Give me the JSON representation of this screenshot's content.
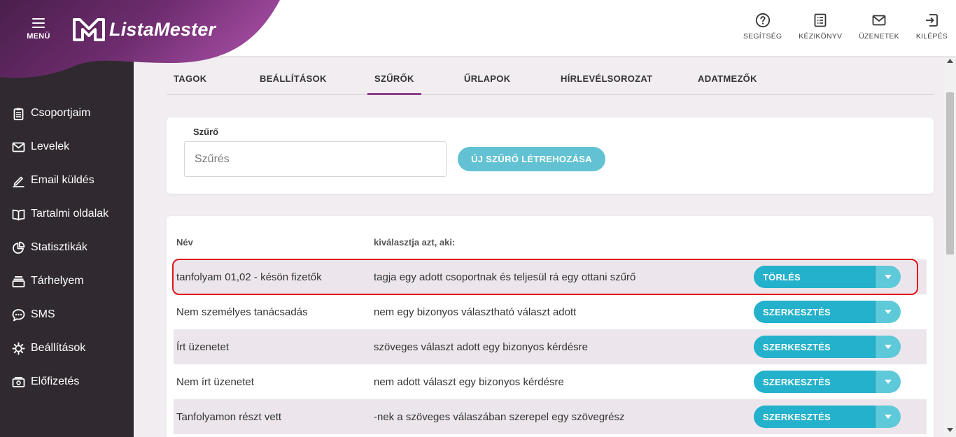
{
  "header": {
    "menu_label": "MENÜ",
    "logo_text": "ListaMester",
    "actions": [
      {
        "label": "SEGÍTSÉG",
        "icon": "help-icon"
      },
      {
        "label": "KÉZIKÖNYV",
        "icon": "manual-icon"
      },
      {
        "label": "ÜZENETEK",
        "icon": "mail-icon"
      },
      {
        "label": "KILÉPÉS",
        "icon": "logout-icon"
      }
    ]
  },
  "sidebar": {
    "items": [
      {
        "label": "Csoportjaim",
        "icon": "clipboard-icon"
      },
      {
        "label": "Levelek",
        "icon": "envelope-icon"
      },
      {
        "label": "Email küldés",
        "icon": "pen-icon"
      },
      {
        "label": "Tartalmi oldalak",
        "icon": "book-icon"
      },
      {
        "label": "Statisztikák",
        "icon": "pie-chart-icon"
      },
      {
        "label": "Tárhelyem",
        "icon": "storage-icon"
      },
      {
        "label": "SMS",
        "icon": "chat-bubble-icon"
      },
      {
        "label": "Beállítások",
        "icon": "gear-icon"
      },
      {
        "label": "Előfizetés",
        "icon": "subscription-icon"
      }
    ]
  },
  "tabs": [
    {
      "label": "TAGOK"
    },
    {
      "label": "BEÁLLÍTÁSOK"
    },
    {
      "label": "SZŰRŐK",
      "active": true
    },
    {
      "label": "ŰRLAPOK"
    },
    {
      "label": "HÍRLEVÉLSOROZAT"
    },
    {
      "label": "ADATMEZŐK"
    }
  ],
  "filter": {
    "label": "Szűrő",
    "input_value": "",
    "input_placeholder": "Szűrés",
    "new_button_label": "ÚJ SZŰRŐ LÉTREHOZÁSA"
  },
  "table": {
    "headers": {
      "name": "Név",
      "description": "kiválasztja azt, aki:"
    },
    "rows": [
      {
        "name": "tanfolyam 01,02 - késön fizetők",
        "description": "tagja egy adott csoportnak és teljesül rá egy ottani szűrő",
        "action": "TÖRLÉS"
      },
      {
        "name": "Nem személyes tanácsadás",
        "description": "nem egy bizonyos választható választ adott",
        "action": "SZERKESZTÉS"
      },
      {
        "name": "Írt üzenetet",
        "description": "szöveges választ adott egy bizonyos kérdésre",
        "action": "SZERKESZTÉS"
      },
      {
        "name": "Nem írt üzenetet",
        "description": "nem adott választ egy bizonyos kérdésre",
        "action": "SZERKESZTÉS"
      },
      {
        "name": "Tanfolyamon részt vett",
        "description": "-nek a szöveges válaszában szerepel egy szövegrész",
        "action": "SZERKESZTÉS"
      }
    ]
  },
  "colors": {
    "brand_purple_dark": "#4a1f4c",
    "brand_purple_light": "#a04a9e",
    "sidebar_bg": "#302a30",
    "accent_teal": "#24b1cb",
    "accent_teal_light": "#62c2d3",
    "highlight_red": "#e0141b",
    "active_tab_underline": "#8a3f88"
  }
}
